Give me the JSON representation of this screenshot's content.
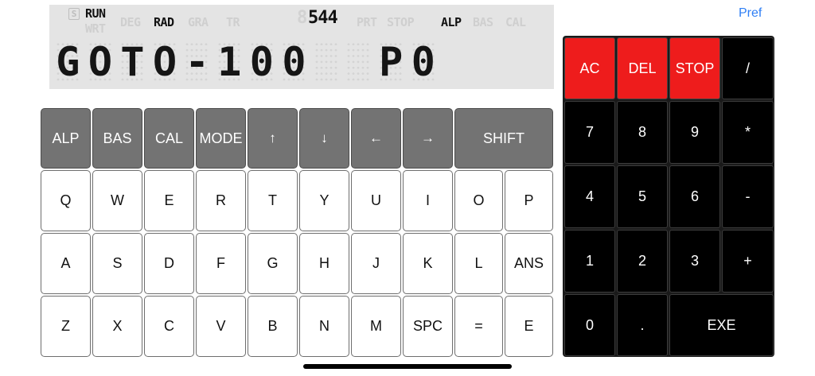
{
  "display": {
    "indicators": {
      "s": "S",
      "run": "RUN",
      "wrt": "WRT",
      "deg": "DEG",
      "rad": "RAD",
      "gra": "GRA",
      "tr": "TR",
      "counter_ghost": "8",
      "counter": "544",
      "prt": "PRT",
      "stop": "STOP",
      "alp": "ALP",
      "bas": "BAS",
      "cal": "CAL"
    },
    "chars": [
      "G",
      "O",
      "T",
      "O",
      "-",
      "1",
      "0",
      "0",
      "",
      "",
      "P",
      "0"
    ]
  },
  "pref_label": "Pref",
  "mode_row": {
    "alp": "ALP",
    "bas": "BAS",
    "cal": "CAL",
    "mode": "MODE",
    "up": "↑",
    "down": "↓",
    "left": "←",
    "right": "→",
    "shift": "SHIFT"
  },
  "keyboard": {
    "row1": [
      "Q",
      "W",
      "E",
      "R",
      "T",
      "Y",
      "U",
      "I",
      "O",
      "P"
    ],
    "row2": [
      "A",
      "S",
      "D",
      "F",
      "G",
      "H",
      "J",
      "K",
      "L",
      "ANS"
    ],
    "row3": [
      "Z",
      "X",
      "C",
      "V",
      "B",
      "N",
      "M",
      "SPC",
      "=",
      "E"
    ]
  },
  "keypad": {
    "ac": "AC",
    "del": "DEL",
    "stop": "STOP",
    "divide": "/",
    "k7": "7",
    "k8": "8",
    "k9": "9",
    "multiply": "*",
    "k4": "4",
    "k5": "5",
    "k6": "6",
    "minus": "-",
    "k1": "1",
    "k2": "2",
    "k3": "3",
    "plus": "+",
    "k0": "0",
    "dot": ".",
    "exe": "EXE"
  },
  "colors": {
    "function_red": "#ee1c1c",
    "link_blue": "#2f7ff5",
    "mode_gray": "#737373",
    "lcd_bg": "#e4e4e4"
  }
}
